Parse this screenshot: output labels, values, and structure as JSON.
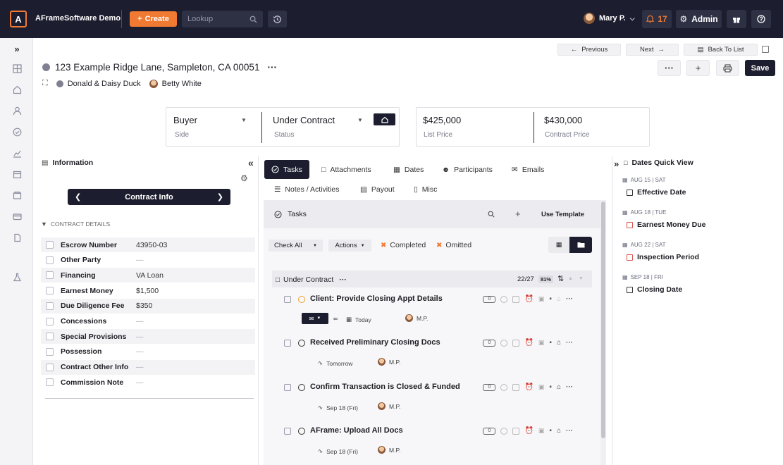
{
  "topbar": {
    "logo_letter": "A",
    "app_name": "AFrameSoftware Demo",
    "create_label": "Create",
    "lookup_placeholder": "Lookup",
    "user_name": "Mary P.",
    "notification_count": "17",
    "admin_label": "Admin"
  },
  "nav_links": {
    "previous": "Previous",
    "next": "Next",
    "back_to_list": "Back To List"
  },
  "header": {
    "address": "123 Example Ridge Lane, Sampleton, CA 00051",
    "clients": "Donald & Daisy Duck",
    "agent": "Betty White",
    "save_label": "Save"
  },
  "summary": {
    "side_value": "Buyer",
    "side_label": "Side",
    "status_value": "Under Contract",
    "status_label": "Status",
    "list_price_value": "$425,000",
    "list_price_label": "List Price",
    "contract_price_value": "$430,000",
    "contract_price_label": "Contract Price"
  },
  "info_panel": {
    "title": "Information",
    "section_nav": "Contract Info",
    "section_header": "CONTRACT DETAILS",
    "rows": [
      {
        "label": "Escrow Number",
        "value": "43950-03"
      },
      {
        "label": "Other Party",
        "value": "—"
      },
      {
        "label": "Financing",
        "value": "VA Loan"
      },
      {
        "label": "Earnest Money",
        "value": "$1,500"
      },
      {
        "label": "Due Diligence Fee",
        "value": "$350"
      },
      {
        "label": "Concessions",
        "value": "—"
      },
      {
        "label": "Special Provisions",
        "value": "—"
      },
      {
        "label": "Possession",
        "value": "—"
      },
      {
        "label": "Contract Other Info",
        "value": "—"
      },
      {
        "label": "Commission Note",
        "value": "—"
      }
    ]
  },
  "tabs": {
    "tasks": "Tasks",
    "attachments": "Attachments",
    "dates": "Dates",
    "participants": "Participants",
    "emails": "Emails",
    "notes": "Notes / Activities",
    "payout": "Payout",
    "misc": "Misc"
  },
  "tasks_panel": {
    "title": "Tasks",
    "use_template": "Use Template",
    "check_all": "Check All",
    "actions": "Actions",
    "completed": "Completed",
    "omitted": "Omitted",
    "group_name": "Under Contract",
    "group_count": "22/27",
    "group_percent": "81%",
    "tasks": [
      {
        "title": "Client: Provide Closing Appt Details",
        "comments": "0",
        "due": "Today",
        "assignee": "M.P."
      },
      {
        "title": "Received Preliminary Closing Docs",
        "comments": "0",
        "due": "Tomorrow",
        "assignee": "M.P."
      },
      {
        "title": "Confirm Transaction is Closed & Funded",
        "comments": "0",
        "due": "Sep 18 (Fri)",
        "assignee": "M.P."
      },
      {
        "title": "AFrame: Upload All Docs",
        "comments": "0",
        "due": "Sep 18 (Fri)",
        "assignee": "M.P."
      }
    ]
  },
  "dates_panel": {
    "title": "Dates Quick View",
    "items": [
      {
        "date": "AUG 15 | SAT",
        "name": "Effective Date",
        "status": "normal"
      },
      {
        "date": "AUG 18 | TUE",
        "name": "Earnest Money Due",
        "status": "overdue"
      },
      {
        "date": "AUG 22 | SAT",
        "name": "Inspection Period",
        "status": "overdue"
      },
      {
        "date": "SEP 18 | FRI",
        "name": "Closing Date",
        "status": "normal"
      }
    ]
  },
  "colors": {
    "accent": "#f07a32",
    "dark": "#1c1d2e",
    "overdue": "#d9534f"
  }
}
